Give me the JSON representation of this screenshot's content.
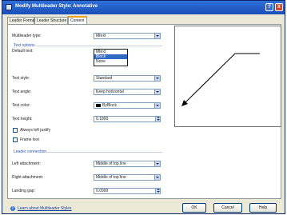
{
  "window": {
    "title": "Modify Multileader Style: Annotative",
    "help_glyph": "?",
    "close_glyph": "X"
  },
  "tabs": [
    {
      "label": "Leader Format"
    },
    {
      "label": "Leader Structure"
    },
    {
      "label": "Content"
    }
  ],
  "content": {
    "multileader_type": {
      "label": "Multileader type:",
      "value": "Mtext",
      "options": [
        "Mtext",
        "Block",
        "None"
      ]
    },
    "text_options": {
      "header": "Text options",
      "default_text": {
        "label": "Default text:"
      },
      "text_style": {
        "label": "Text style:",
        "value": "Standard"
      },
      "text_angle": {
        "label": "Text angle:",
        "value": "Keep horizontal"
      },
      "text_color": {
        "label": "Text color:",
        "value": "ByBlock",
        "swatch": "#000000"
      },
      "text_height": {
        "label": "Text height:",
        "value": "0.1800"
      },
      "always_left_justify": {
        "label": "Always left justify",
        "checked": false
      },
      "frame_text": {
        "label": "Frame text",
        "checked": false
      }
    },
    "leader_connection": {
      "header": "Leader connection",
      "left_attachment": {
        "label": "Left attachment:",
        "value": "Middle of top line"
      },
      "right_attachment": {
        "label": "Right attachment:",
        "value": "Middle of top line"
      },
      "landing_gap": {
        "label": "Landing gap:",
        "value": "0.0900"
      }
    }
  },
  "footer": {
    "help_link": "Learn about Multileader Styles",
    "ok": "OK",
    "cancel": "Cancel",
    "help": "Help"
  }
}
